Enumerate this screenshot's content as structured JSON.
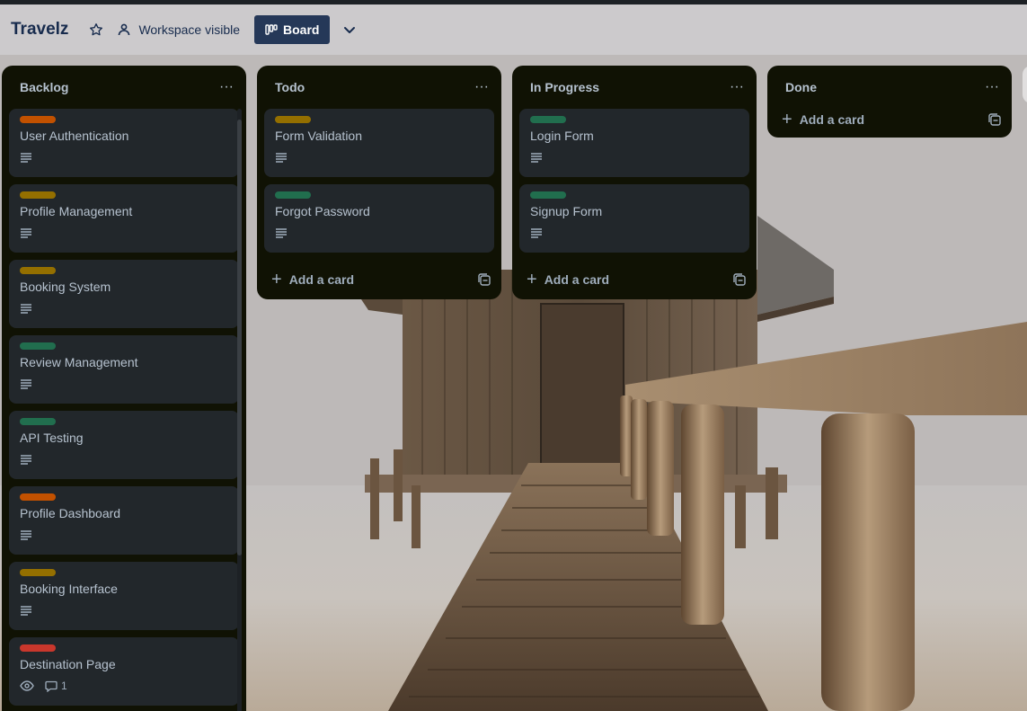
{
  "header": {
    "board_title": "Travelz",
    "star_icon": "star-icon",
    "visibility_label": "Workspace visible",
    "view_label": "Board",
    "chevron_icon": "chevron-down-icon"
  },
  "colors": {
    "list_bg": "#101204",
    "card_bg": "#22272b",
    "text": "#b6c2cf",
    "label_orange": "#c25100",
    "label_yellow": "#946f00",
    "label_green": "#216e4e",
    "label_red": "#c9372c",
    "view_button": "#253858"
  },
  "lists": [
    {
      "title": "Backlog",
      "cards": [
        {
          "title": "User Authentication",
          "label_color": "#c25100",
          "badges": [
            "description-icon"
          ]
        },
        {
          "title": "Profile Management",
          "label_color": "#946f00",
          "badges": [
            "description-icon"
          ]
        },
        {
          "title": "Booking System",
          "label_color": "#946f00",
          "badges": [
            "description-icon"
          ]
        },
        {
          "title": "Review Management",
          "label_color": "#216e4e",
          "badges": [
            "description-icon"
          ]
        },
        {
          "title": "API Testing",
          "label_color": "#216e4e",
          "badges": [
            "description-icon"
          ]
        },
        {
          "title": "Profile Dashboard",
          "label_color": "#c25100",
          "badges": [
            "description-icon"
          ]
        },
        {
          "title": "Booking Interface",
          "label_color": "#946f00",
          "badges": [
            "description-icon"
          ]
        },
        {
          "title": "Destination Page",
          "label_color": "#c9372c",
          "badges": [
            "eye-icon",
            "comment-icon"
          ],
          "comment_count": "1"
        }
      ]
    },
    {
      "title": "Todo",
      "cards": [
        {
          "title": "Form Validation",
          "label_color": "#946f00",
          "badges": [
            "description-icon"
          ]
        },
        {
          "title": "Forgot Password",
          "label_color": "#216e4e",
          "badges": [
            "description-icon"
          ]
        }
      ],
      "add_label": "Add a card"
    },
    {
      "title": "In Progress",
      "cards": [
        {
          "title": "Login Form",
          "label_color": "#216e4e",
          "badges": [
            "description-icon"
          ]
        },
        {
          "title": "Signup Form",
          "label_color": "#216e4e",
          "badges": [
            "description-icon"
          ]
        }
      ],
      "add_label": "Add a card"
    },
    {
      "title": "Done",
      "cards": [],
      "add_label": "Add a card"
    }
  ],
  "list_menu_glyph": "···",
  "add_glyph": "+"
}
